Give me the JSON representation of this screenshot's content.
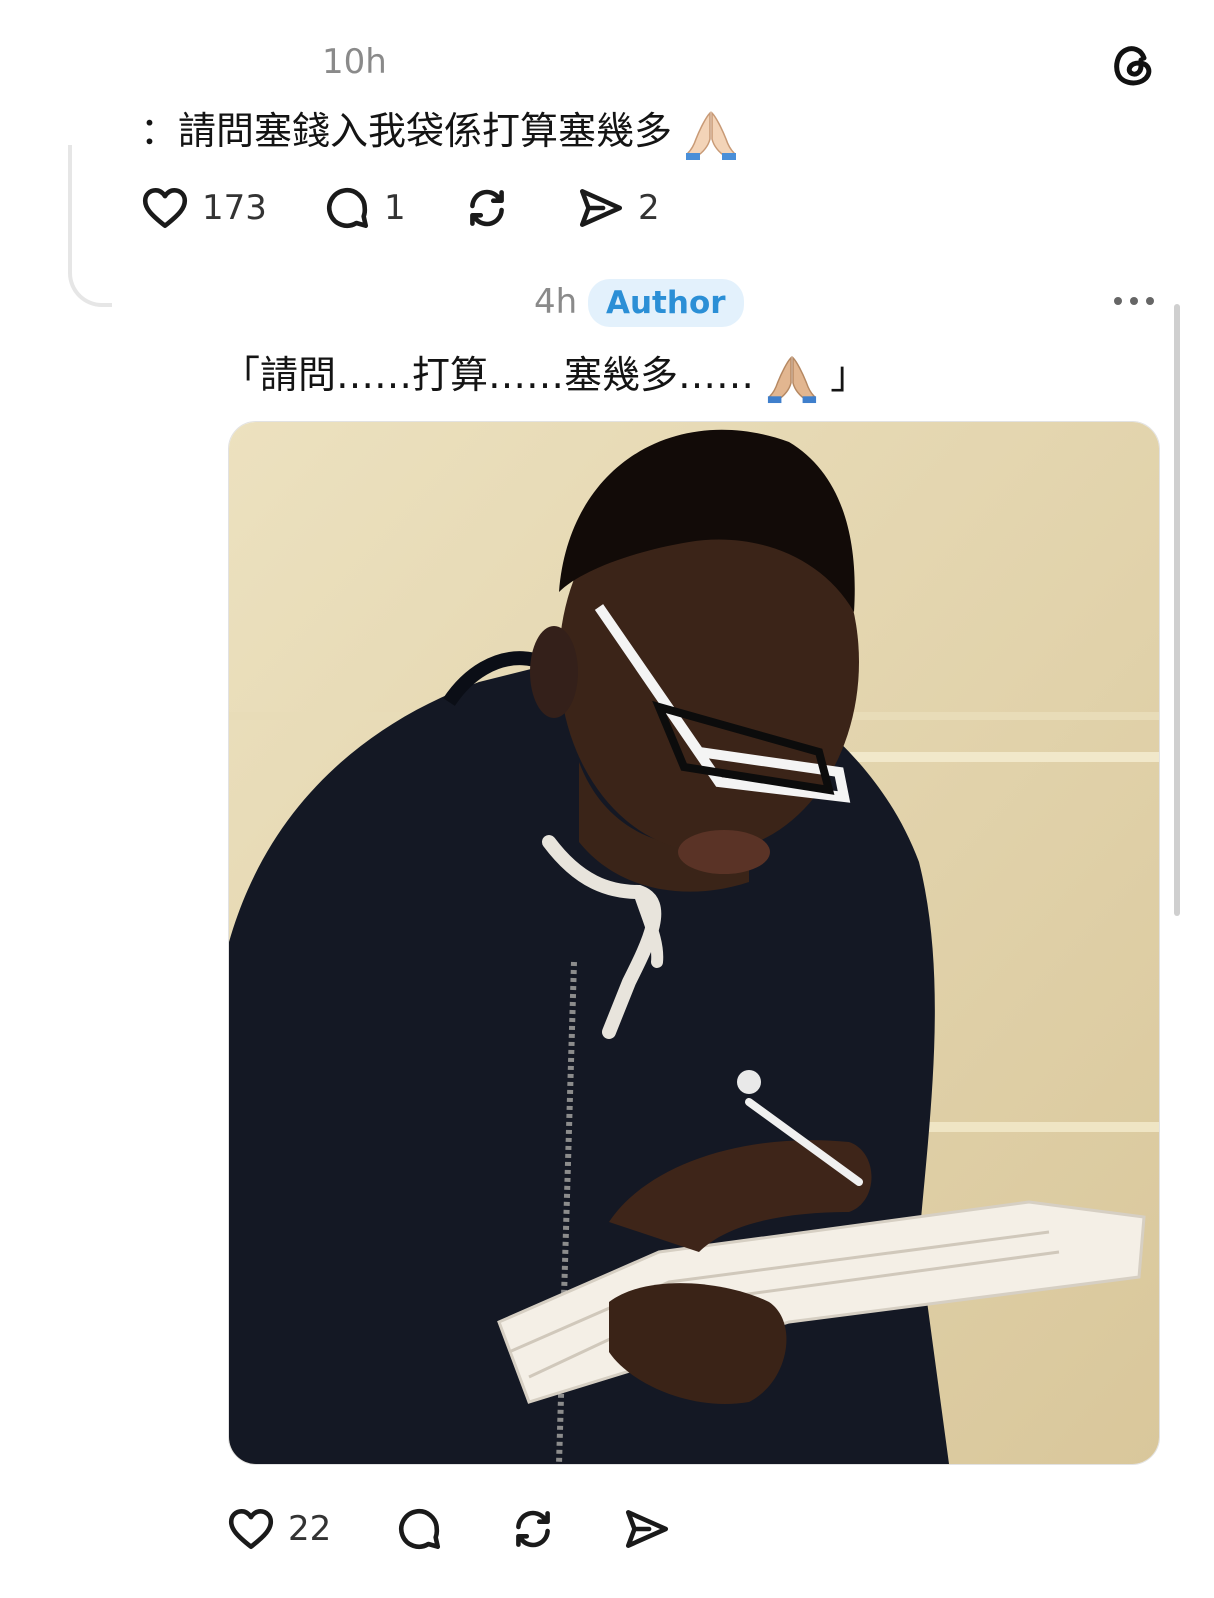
{
  "reply1": {
    "time": "10h",
    "text": "：請問塞錢入我袋係打算塞幾多",
    "like_count": "173",
    "comment_count": "1",
    "share_count": "2"
  },
  "reply2": {
    "time": "4h",
    "badge": "Author",
    "text": "「請問……打算……塞幾多……",
    "text_close": "」",
    "like_count": "22"
  },
  "icons": {
    "app_logo": "threads-logo-icon",
    "like": "heart-icon",
    "comment": "comment-bubble-icon",
    "repost": "repost-icon",
    "share": "send-icon",
    "more": "more-options-icon",
    "emoji": "folded-hands-emoji"
  },
  "colors": {
    "badge_bg": "#e3f1fc",
    "badge_text": "#2b8fd6",
    "muted_text": "#8a8a8a"
  }
}
